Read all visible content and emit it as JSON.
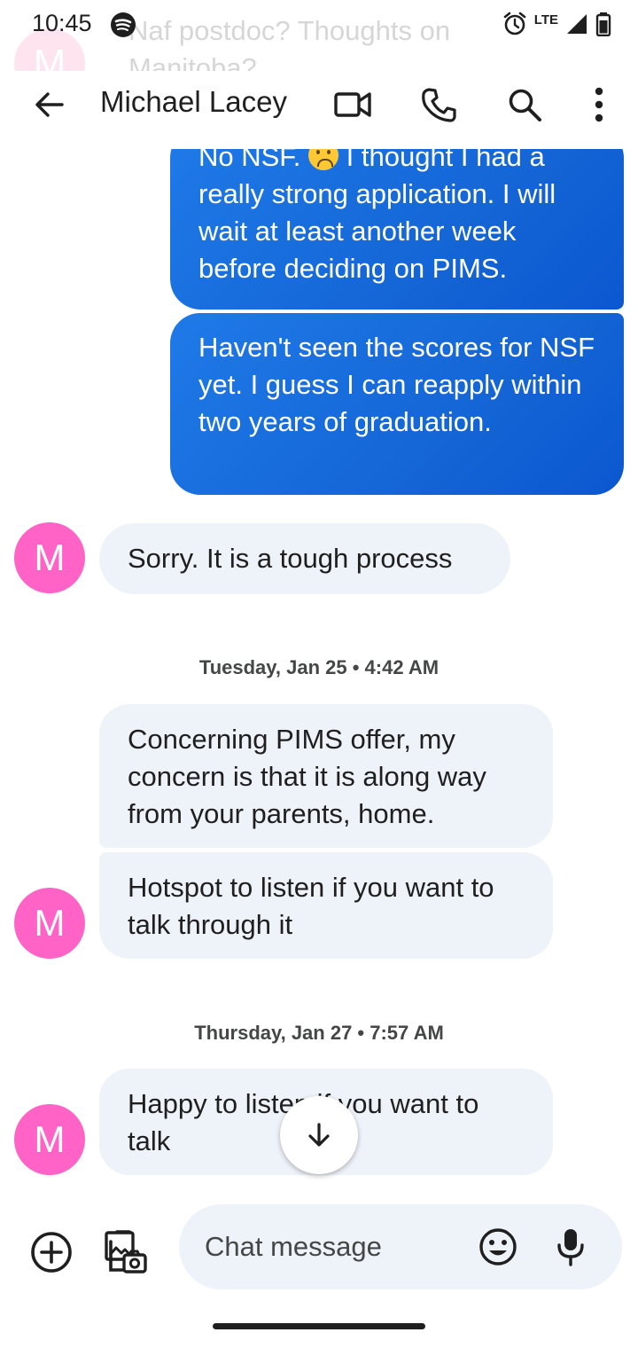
{
  "status_bar": {
    "time": "10:45",
    "network": "LTE",
    "notification_preview": "Naf postdoc? Thoughts on Manitoba?",
    "notification_avatar": "M"
  },
  "header": {
    "contact_name": "Michael Lacey",
    "icons": [
      "back-arrow-icon",
      "video-call-icon",
      "phone-icon",
      "search-icon",
      "more-vert-icon"
    ]
  },
  "messages": [
    {
      "type": "sent",
      "before_emoji": "No NSF. ",
      "after_emoji": " I thought I had a really strong application. I will wait at least another week before deciding on PIMS.",
      "emoji": "slightly-frowning-face"
    },
    {
      "type": "sent",
      "text": "Haven't seen the scores for NSF yet. I guess I can reapply within two years of graduation."
    },
    {
      "type": "received",
      "text": "Sorry. It is a tough process",
      "avatar": "M"
    },
    {
      "type": "date",
      "text": "Tuesday, Jan 25 • 4:42 AM"
    },
    {
      "type": "received",
      "text": "Concerning PIMS offer, my concern is that it is along way from your parents, home."
    },
    {
      "type": "received",
      "text": "Hotspot to listen if you want to talk through it",
      "avatar": "M"
    },
    {
      "type": "date",
      "text": "Thursday, Jan 27 • 7:57 AM"
    },
    {
      "type": "received",
      "text": "Happy to listen if you want to talk",
      "avatar": "M"
    }
  ],
  "compose": {
    "placeholder": "Chat message",
    "icons": [
      "add-circle-icon",
      "gallery-camera-icon",
      "emoji-icon",
      "mic-icon"
    ]
  },
  "colors": {
    "sent_bubble": "#1a6fe0",
    "received_bubble": "#eef2f9",
    "avatar": "#ff63c6"
  }
}
